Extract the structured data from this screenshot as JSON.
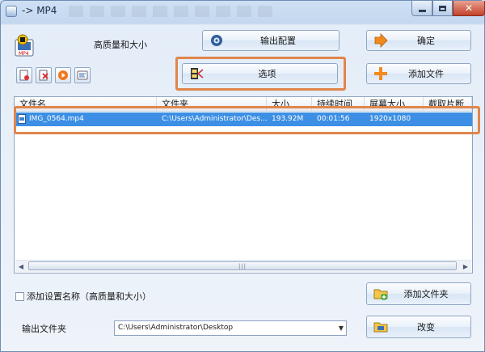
{
  "window": {
    "title": "-> MP4"
  },
  "profile": {
    "label": "高质量和大小"
  },
  "buttons": {
    "output_config": "输出配置",
    "ok": "确定",
    "options": "选项",
    "add_file": "添加文件",
    "add_folder": "添加文件夹",
    "change": "改变"
  },
  "file_list": {
    "columns": [
      "文件名",
      "文件夹",
      "大小",
      "持续时间",
      "屏幕大小",
      "截取片断"
    ],
    "rows": [
      [
        "IMG_0564.mp4",
        "C:\\Users\\Administrator\\Des...",
        "193.92M",
        "00:01:56",
        "1920x1080",
        ""
      ]
    ]
  },
  "options_area": {
    "add_setting_name_label": "添加设置名称（高质量和大小）",
    "add_setting_name_checked": false,
    "output_folder_label": "输出文件夹",
    "output_folder_value": "C:\\Users\\Administrator\\Desktop"
  },
  "colors": {
    "accent_highlight": "#e0864a",
    "selected_row": "#3c8fe4"
  }
}
